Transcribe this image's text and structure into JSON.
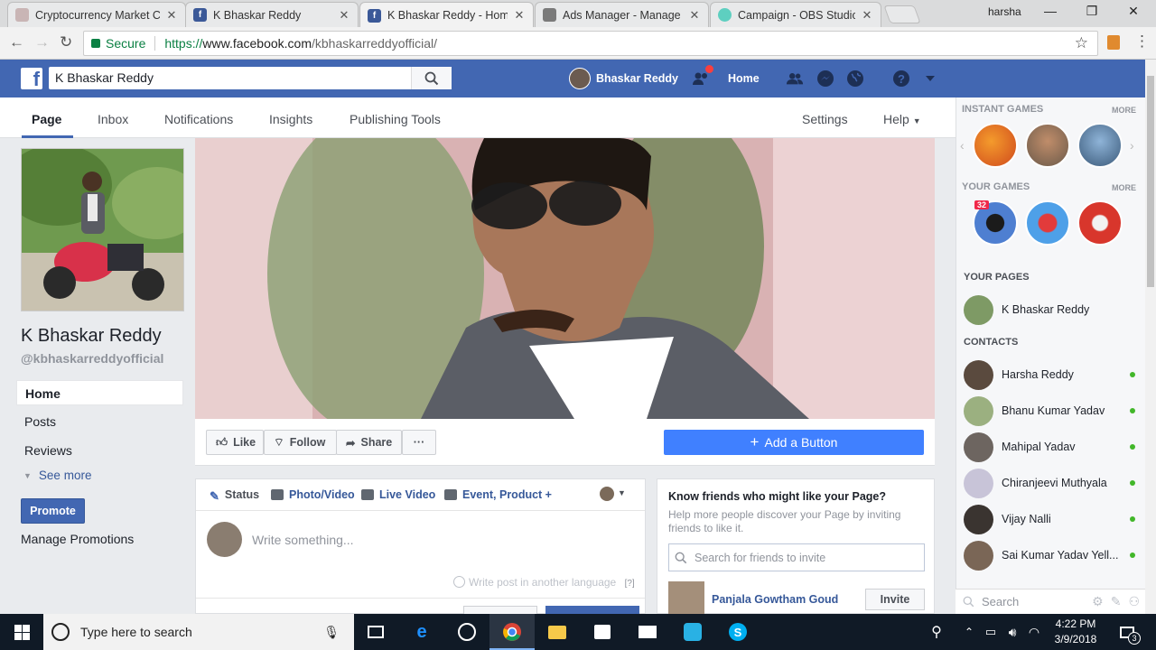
{
  "browser": {
    "tabs": [
      {
        "title": "Cryptocurrency Market C",
        "favicon_color": "#d0c0c0"
      },
      {
        "title": "K Bhaskar Reddy",
        "favicon_color": "#3b5998"
      },
      {
        "title": "K Bhaskar Reddy - Home",
        "favicon_color": "#3b5998"
      },
      {
        "title": "Ads Manager - Manage A",
        "favicon_color": "#7a7a7a"
      },
      {
        "title": "Campaign - OBS Studio (",
        "favicon_color": "#5ecfc0"
      }
    ],
    "profile_name": "harsha",
    "secure_label": "Secure",
    "url_scheme": "https://",
    "url_host": "www.facebook.com",
    "url_path": "/kbhaskarreddyofficial/"
  },
  "fb": {
    "search_value": "K Bhaskar Reddy",
    "user_name": "Bhaskar Reddy",
    "home_label": "Home",
    "page_nav": [
      "Page",
      "Inbox",
      "Notifications",
      "Insights",
      "Publishing Tools"
    ],
    "settings_label": "Settings",
    "help_label": "Help"
  },
  "left": {
    "page_name": "K Bhaskar Reddy",
    "handle": "@kbhaskarreddyofficial",
    "nav": [
      "Home",
      "Posts",
      "Reviews"
    ],
    "see_more": "See more",
    "promote": "Promote",
    "manage_promotions": "Manage Promotions"
  },
  "actions": {
    "like": "Like",
    "follow": "Follow",
    "share": "Share",
    "more": "···",
    "add_button": "Add a Button"
  },
  "composer": {
    "tabs": [
      "Status",
      "Photo/Video",
      "Live Video",
      "Event, Product +"
    ],
    "placeholder": "Write something...",
    "another_language": "Write post in another language",
    "help_mark": "[?]"
  },
  "invite": {
    "title": "Know friends who might like your Page?",
    "description": "Help more people discover your Page by inviting friends to like it.",
    "search_placeholder": "Search for friends to invite",
    "suggestion_name": "Panjala Gowtham Goud",
    "invite_label": "Invite"
  },
  "rail": {
    "instant_games": "INSTANT GAMES",
    "your_games": "YOUR GAMES",
    "more": "MORE",
    "game_badge": "32",
    "your_pages": "YOUR PAGES",
    "page_item": "K Bhaskar Reddy",
    "contacts_header": "CONTACTS",
    "contacts": [
      "Harsha Reddy",
      "Bhanu Kumar Yadav",
      "Mahipal Yadav",
      "Chiranjeevi Muthyala",
      "Vijay Nalli",
      "Sai Kumar Yadav Yell..."
    ],
    "search_placeholder": "Search"
  },
  "taskbar": {
    "search_placeholder": "Type here to search",
    "time": "4:22 PM",
    "date": "3/9/2018",
    "notif_count": "3"
  },
  "colors": {
    "fb_blue": "#4267b2",
    "cta_blue": "#4080ff",
    "online_green": "#42b72a"
  }
}
